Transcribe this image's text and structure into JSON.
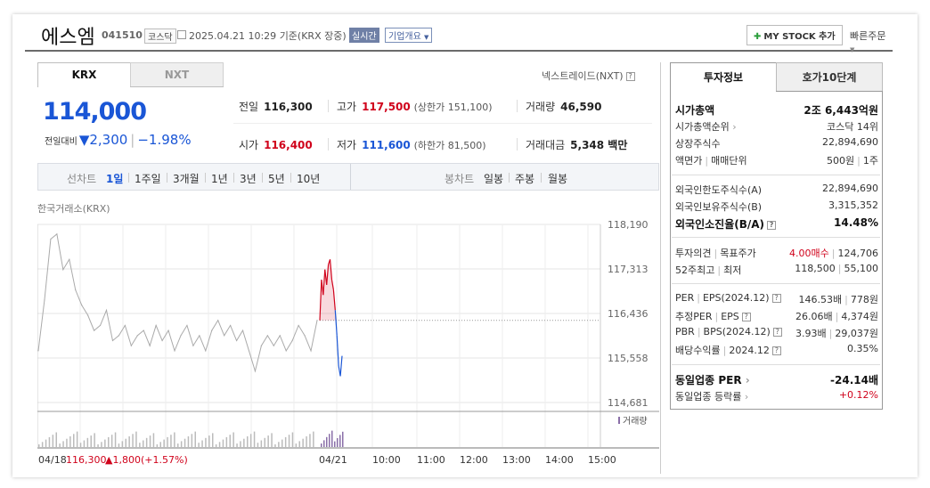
{
  "header": {
    "name": "에스엠",
    "code": "041510",
    "market": "코스닥",
    "datetime": "2025.04.21 10:29",
    "basis": "기준(KRX 장중)",
    "realtime": "실시간",
    "corp_info": "기업개요",
    "mystock": "MY STOCK 추가",
    "quick_order": "빠른주문"
  },
  "tabs": {
    "krx": "KRX",
    "nxt": "NXT"
  },
  "nxt_link": "넥스트레이드(NXT)",
  "quote": {
    "price": "114,000",
    "change_label": "전일대비",
    "change": "▼2,300",
    "change_pct": "−1.98%",
    "prev_label": "전일",
    "prev": "116,300",
    "high_label": "고가",
    "high": "117,500",
    "upper_limit": "(상한가 151,100)",
    "volume_label": "거래량",
    "volume": "46,590",
    "open_label": "시가",
    "open": "116,400",
    "low_label": "저가",
    "low": "111,600",
    "lower_limit": "(하한가 81,500)",
    "amount_label": "거래대금",
    "amount": "5,348 백만"
  },
  "periods": {
    "line_label": "선차트",
    "line": [
      "1일",
      "1주일",
      "3개월",
      "1년",
      "3년",
      "5년",
      "10년"
    ],
    "candle_label": "봉차트",
    "candle": [
      "일봉",
      "주봉",
      "월봉"
    ],
    "active": "1일"
  },
  "exchange_label": "한국거래소(KRX)",
  "chart_data": {
    "type": "line",
    "yticks": [
      "118,190",
      "117,313",
      "116,436",
      "115,558",
      "114,681"
    ],
    "ylim": [
      114681,
      118190
    ],
    "xticks": [
      "04/18",
      "04/21",
      "10:00",
      "11:00",
      "12:00",
      "13:00",
      "14:00",
      "15:00"
    ],
    "volume_label": "거래량",
    "prev_close": 116300,
    "footer": {
      "date": "04/18",
      "close": "116,300",
      "change": "▲1,800",
      "pct": "(+1.57%)"
    },
    "series": [
      {
        "values": [
          115700,
          116700,
          117900,
          118000,
          117300,
          117500,
          116900,
          116600,
          116400,
          116100,
          116200,
          116500,
          115900,
          116000,
          116200,
          115800,
          116000,
          116100,
          115800,
          116200,
          115900,
          116100,
          115700,
          116000,
          116200,
          115800,
          116000,
          115700,
          116100,
          116300,
          116000,
          116200,
          115900,
          116100,
          115700,
          115300,
          115800,
          116000,
          115800,
          116000,
          115700,
          115900,
          116200,
          116000,
          115700,
          116300
        ]
      },
      {
        "values": [
          116300,
          117100,
          116800,
          117300,
          117000,
          117400,
          117500,
          117100,
          116900,
          116500,
          116000,
          115400,
          115200,
          115600
        ]
      }
    ]
  },
  "right": {
    "tabs": [
      "투자정보",
      "호가10단계"
    ],
    "market_cap": {
      "k": "시가총액",
      "v": "2조 6,443억원"
    },
    "cap_rank": {
      "k": "시가총액순위",
      "v": "코스닥 14위"
    },
    "listed": {
      "k": "상장주식수",
      "v": "22,894,690"
    },
    "face": {
      "k": "액면가",
      "k2": "매매단위",
      "v": "500원",
      "v2": "1주"
    },
    "foreign_limit": {
      "k": "외국인한도주식수(A)",
      "v": "22,894,690"
    },
    "foreign_hold": {
      "k": "외국인보유주식수(B)",
      "v": "3,315,352"
    },
    "foreign_ratio": {
      "k": "외국인소진율(B/A)",
      "v": "14.48%"
    },
    "opinion": {
      "k": "투자의견",
      "k2": "목표주가",
      "v": "4.00매수",
      "v2": "124,706"
    },
    "w52": {
      "k": "52주최고",
      "k2": "최저",
      "v": "118,500",
      "v2": "55,100"
    },
    "per": {
      "k": "PER",
      "k2": "EPS(2024.12)",
      "v": "146.53배",
      "v2": "778원"
    },
    "est_per": {
      "k": "추정PER",
      "k2": "EPS",
      "v": "26.06배",
      "v2": "4,374원"
    },
    "pbr": {
      "k": "PBR",
      "k2": "BPS(2024.12)",
      "v": "3.93배",
      "v2": "29,037원"
    },
    "dividend": {
      "k": "배당수익률",
      "k2": "2024.12",
      "v": "0.35%"
    },
    "ind_per": {
      "k": "동일업종 PER",
      "v": "-24.14배"
    },
    "ind_rate": {
      "k": "동일업종 등락률",
      "v": "+0.12%"
    }
  },
  "colors": {
    "up": "#d0021b",
    "down": "#1a56d6"
  }
}
